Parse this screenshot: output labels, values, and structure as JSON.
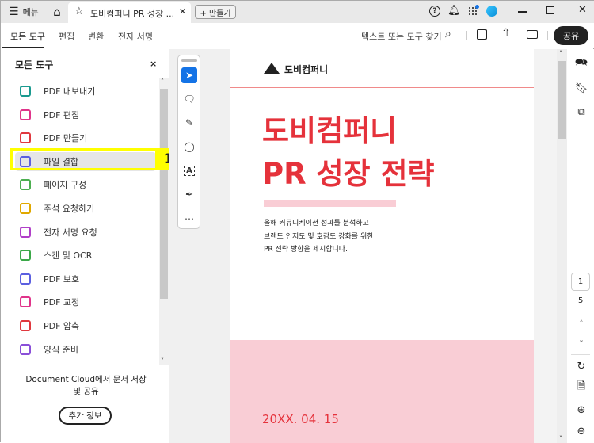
{
  "titlebar": {
    "menu_label": "메뉴",
    "tab_title": "도비컴퍼니 PR 성장 ...",
    "create_label": "+ 만들기"
  },
  "toolbar": {
    "tabs": [
      "모든 도구",
      "편집",
      "변환",
      "전자 서명"
    ],
    "search_label": "텍스트 또는 도구 찾기",
    "share_label": "공유"
  },
  "left_panel": {
    "title": "모든 도구",
    "items": [
      {
        "label": "PDF 내보내기",
        "color": "#1a9a8f"
      },
      {
        "label": "PDF 편집",
        "color": "#e0348a"
      },
      {
        "label": "PDF 만들기",
        "color": "#e0383e"
      },
      {
        "label": "파일 결합",
        "color": "#5b5fe0"
      },
      {
        "label": "페이지 구성",
        "color": "#4caf50"
      },
      {
        "label": "주석 요청하기",
        "color": "#e0a800"
      },
      {
        "label": "전자 서명 요청",
        "color": "#b03fc8"
      },
      {
        "label": "스캔 및 OCR",
        "color": "#3aa848"
      },
      {
        "label": "PDF 보호",
        "color": "#5b5fe0"
      },
      {
        "label": "PDF 교정",
        "color": "#e0348a"
      },
      {
        "label": "PDF 압축",
        "color": "#e0383e"
      },
      {
        "label": "양식 준비",
        "color": "#8a4fd8"
      }
    ],
    "promo_text": "Document Cloud에서 문서 저장 및 공유",
    "more_info_label": "추가 정보"
  },
  "annotation": {
    "badge": "1",
    "highlight_color": "#ffff00"
  },
  "document": {
    "company": "도비컴퍼니",
    "title_line1": "도비컴퍼니",
    "title_line2": "PR 성장 전략",
    "body_lines": [
      "올해 커뮤니케이션 성과를 분석하고",
      "브랜드 인지도 및 호감도 강화를 위한",
      "PR 전략 방향을 제시합니다."
    ],
    "date": "20XX. 04. 15",
    "accent": "#e5323b",
    "pink": "#f9cdd5"
  },
  "page_nav": {
    "current": "1",
    "total": "5"
  }
}
